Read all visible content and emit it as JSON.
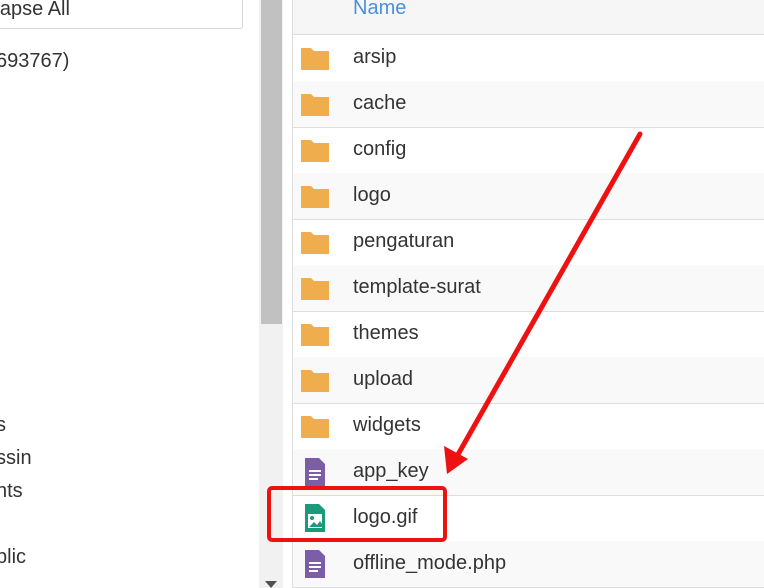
{
  "tree": {
    "collapse_label": "llapse All",
    "root_label": "693767)",
    "items": [
      "s",
      "ssin",
      "nts",
      "blic"
    ]
  },
  "file_list": {
    "header": "Name",
    "rows": [
      {
        "name": "arsip",
        "icon": "folder-icon"
      },
      {
        "name": "cache",
        "icon": "folder-icon"
      },
      {
        "name": "config",
        "icon": "folder-icon"
      },
      {
        "name": "logo",
        "icon": "folder-icon"
      },
      {
        "name": "pengaturan",
        "icon": "folder-icon"
      },
      {
        "name": "template-surat",
        "icon": "folder-icon"
      },
      {
        "name": "themes",
        "icon": "folder-icon"
      },
      {
        "name": "upload",
        "icon": "folder-icon"
      },
      {
        "name": "widgets",
        "icon": "folder-icon"
      },
      {
        "name": "app_key",
        "icon": "text-file-icon"
      },
      {
        "name": "logo.gif",
        "icon": "image-file-icon"
      },
      {
        "name": "offline_mode.php",
        "icon": "text-file-icon"
      }
    ]
  },
  "colors": {
    "folder": "#f0ad4e",
    "text_file": "#7b5ea7",
    "image_file": "#1a9a7a",
    "link": "#4a90d9",
    "annotation": "#ee1111"
  }
}
